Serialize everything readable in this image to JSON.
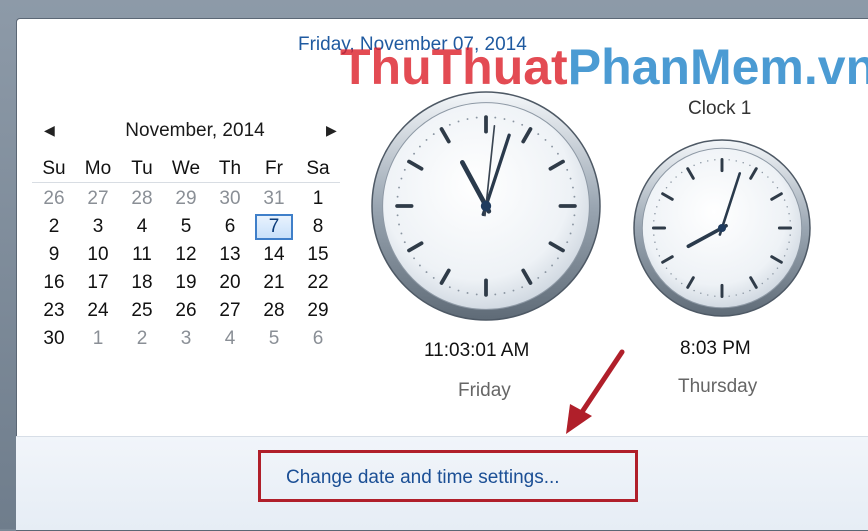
{
  "header": {
    "full_date": "Friday, November 07, 2014",
    "watermark_part1": "ThuThuat",
    "watermark_part2": "PhanMem",
    "watermark_part3": ".vn"
  },
  "calendar": {
    "month_title": "November, 2014",
    "prev_icon": "left-triangle-icon",
    "next_icon": "right-triangle-icon",
    "weekdays": [
      "Su",
      "Mo",
      "Tu",
      "We",
      "Th",
      "Fr",
      "Sa"
    ],
    "weeks": [
      [
        "26",
        "27",
        "28",
        "29",
        "30",
        "31",
        "1"
      ],
      [
        "2",
        "3",
        "4",
        "5",
        "6",
        "7",
        "8"
      ],
      [
        "9",
        "10",
        "11",
        "12",
        "13",
        "14",
        "15"
      ],
      [
        "16",
        "17",
        "18",
        "19",
        "20",
        "21",
        "22"
      ],
      [
        "23",
        "24",
        "25",
        "26",
        "27",
        "28",
        "29"
      ],
      [
        "30",
        "1",
        "2",
        "3",
        "4",
        "5",
        "6"
      ]
    ],
    "selected_day": "7"
  },
  "clocks": {
    "main": {
      "time": "11:03:01 AM",
      "day": "Friday",
      "hour": 11,
      "minute": 3,
      "second": 1
    },
    "extra": {
      "name": "Clock 1",
      "time": "8:03 PM",
      "day": "Thursday",
      "hour": 20,
      "minute": 3
    }
  },
  "footer": {
    "settings_link": "Change date and time settings..."
  },
  "colors": {
    "link": "#1b4f95",
    "highlight_box": "#b01f2a",
    "selected_day_border": "#3f7fc9"
  }
}
